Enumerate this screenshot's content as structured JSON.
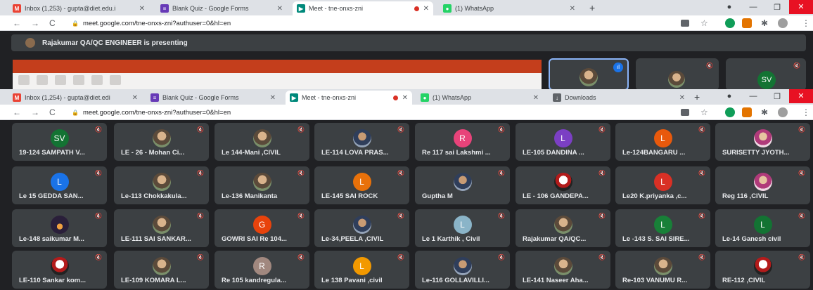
{
  "browser_top": {
    "tabs": [
      {
        "title": "Inbox (1,253) - gupta@diet.edu.i",
        "favicon_color": "#ea4335",
        "glyph": "M"
      },
      {
        "title": "Blank Quiz - Google Forms",
        "favicon_color": "#673ab7",
        "glyph": "≡"
      },
      {
        "title": "Meet - tne-onxs-zni",
        "favicon_color": "#00897b",
        "glyph": "▶"
      },
      {
        "title": "(1) WhatsApp",
        "favicon_color": "#25d366",
        "glyph": "●"
      }
    ],
    "url": "meet.google.com/tne-onxs-zni?authuser=0&hl=en"
  },
  "presenting": {
    "text": "Rajakumar QA/QC ENGINEER is presenting",
    "initials": "SV"
  },
  "browser_inner": {
    "tabs": [
      {
        "title": "Inbox (1,254) - gupta@diet.edi",
        "favicon_color": "#ea4335",
        "glyph": "M"
      },
      {
        "title": "Blank Quiz - Google Forms",
        "favicon_color": "#673ab7",
        "glyph": "≡"
      },
      {
        "title": "Meet - tne-onxs-zni",
        "favicon_color": "#00897b",
        "glyph": "▶"
      },
      {
        "title": "(1) WhatsApp",
        "favicon_color": "#25d366",
        "glyph": "●"
      },
      {
        "title": "Downloads",
        "favicon_color": "#5f6368",
        "glyph": "↓"
      }
    ],
    "url": "meet.google.com/tne-onxs-zni?authuser=0&hl=en"
  },
  "participants": [
    {
      "name": "19-124 SAMPATH V...",
      "avatar": "initial",
      "initial": "SV",
      "color": "#137333"
    },
    {
      "name": "LE - 26 - Mohan Ci...",
      "avatar": "photo"
    },
    {
      "name": "Le 144-Mani ,CIVIL",
      "avatar": "photo"
    },
    {
      "name": "LE-114 LOVA PRAS...",
      "avatar": "photo2"
    },
    {
      "name": "Re 117 sai Lakshmi ...",
      "avatar": "initial",
      "initial": "R",
      "color": "#e8437a"
    },
    {
      "name": "LE-105 DANDINA ...",
      "avatar": "initial",
      "initial": "L",
      "color": "#7b3fc4"
    },
    {
      "name": "Le-124BANGARU ...",
      "avatar": "initial",
      "initial": "L",
      "color": "#e8590c"
    },
    {
      "name": "SURISETTY JYOTH...",
      "avatar": "photo3"
    },
    {
      "name": "Le 15 GEDDA SAN...",
      "avatar": "initial",
      "initial": "L",
      "color": "#1a73e8"
    },
    {
      "name": "Le-113 Chokkakula...",
      "avatar": "photo"
    },
    {
      "name": "Le-136 Manikanta",
      "avatar": "photo"
    },
    {
      "name": "LE-145 SAI ROCK",
      "avatar": "initial",
      "initial": "L",
      "color": "#e8710a"
    },
    {
      "name": "Guptha M",
      "avatar": "photo2"
    },
    {
      "name": "LE - 106 GANDEPA...",
      "avatar": "photo5"
    },
    {
      "name": "Le20 K.priyanka ,c...",
      "avatar": "initial",
      "initial": "L",
      "color": "#d93025"
    },
    {
      "name": "Reg 116 ,CIVIL",
      "avatar": "photo3"
    },
    {
      "name": "Le-148 saikumar M...",
      "avatar": "photo4"
    },
    {
      "name": "LE-111 SAI SANKAR...",
      "avatar": "photo"
    },
    {
      "name": "GOWRI SAI Re 104...",
      "avatar": "initial",
      "initial": "G",
      "color": "#e8430c"
    },
    {
      "name": "Le-34,PEELA ,CIVIL",
      "avatar": "photo2"
    },
    {
      "name": "Le 1 Karthik , Civil",
      "avatar": "initial",
      "initial": "L",
      "color": "#8ab4c8"
    },
    {
      "name": "Rajakumar QA/QC...",
      "avatar": "photo"
    },
    {
      "name": "Le -143 S. SAI SIRE...",
      "avatar": "initial",
      "initial": "L",
      "color": "#188038"
    },
    {
      "name": "Le-14 Ganesh civil",
      "avatar": "initial",
      "initial": "L",
      "color": "#137333"
    },
    {
      "name": "LE-110 Sankar kom...",
      "avatar": "photo5"
    },
    {
      "name": "LE-109 KOMARA L...",
      "avatar": "photo"
    },
    {
      "name": "Re 105 kandregula...",
      "avatar": "initial",
      "initial": "R",
      "color": "#a1887f"
    },
    {
      "name": "Le 138 Pavani ,civil",
      "avatar": "initial",
      "initial": "L",
      "color": "#f29900"
    },
    {
      "name": "Le-116 GOLLAVILLI...",
      "avatar": "photo2"
    },
    {
      "name": "LE-141 Naseer Aha...",
      "avatar": "photo"
    },
    {
      "name": "Re-103 VANUMU R...",
      "avatar": "photo"
    },
    {
      "name": "RE-112 ,CIVIL",
      "avatar": "photo5"
    }
  ]
}
